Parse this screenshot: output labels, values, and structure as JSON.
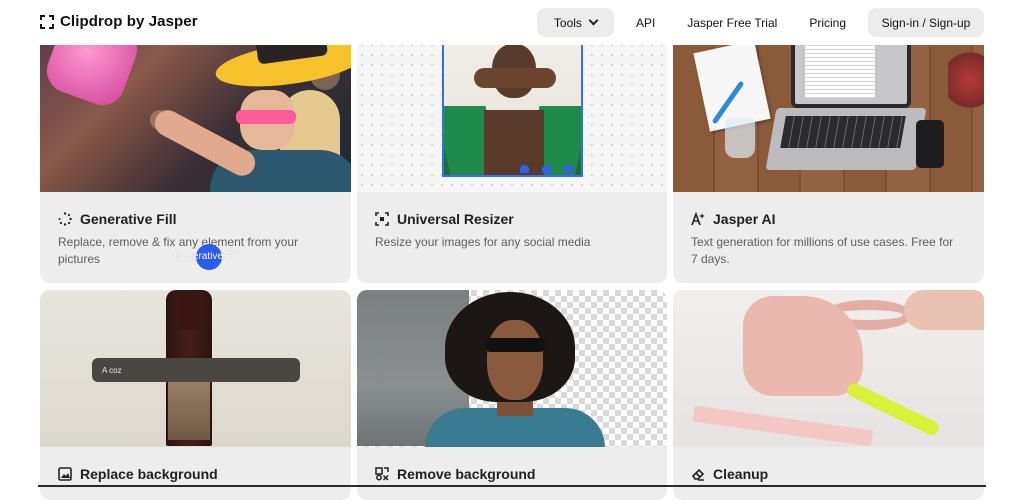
{
  "header": {
    "logo_text": "Clipdrop by Jasper",
    "nav": {
      "tools": "Tools",
      "api": "API",
      "trial": "Jasper Free Trial",
      "pricing": "Pricing",
      "signin": "Sign-in / Sign-up"
    }
  },
  "cards": [
    {
      "title": "Generative Fill",
      "desc": "Replace, remove & fix any element from your pictures",
      "icon": "sparkle-dots-icon",
      "overlay_label": "Generative Fill"
    },
    {
      "title": "Universal Resizer",
      "desc": "Resize your images for any social media",
      "icon": "resize-icon"
    },
    {
      "title": "Jasper AI",
      "desc": "Text generation for millions of use cases. Free for 7 days.",
      "icon": "text-ai-icon"
    },
    {
      "title": "Replace background",
      "icon": "image-replace-icon",
      "prompt_text": "A coz"
    },
    {
      "title": "Remove background",
      "icon": "remove-bg-icon"
    },
    {
      "title": "Cleanup",
      "icon": "eraser-icon"
    }
  ],
  "colors": {
    "accent": "#2d5bf0",
    "card_bg": "#ededed",
    "button_bg": "#ececec"
  }
}
